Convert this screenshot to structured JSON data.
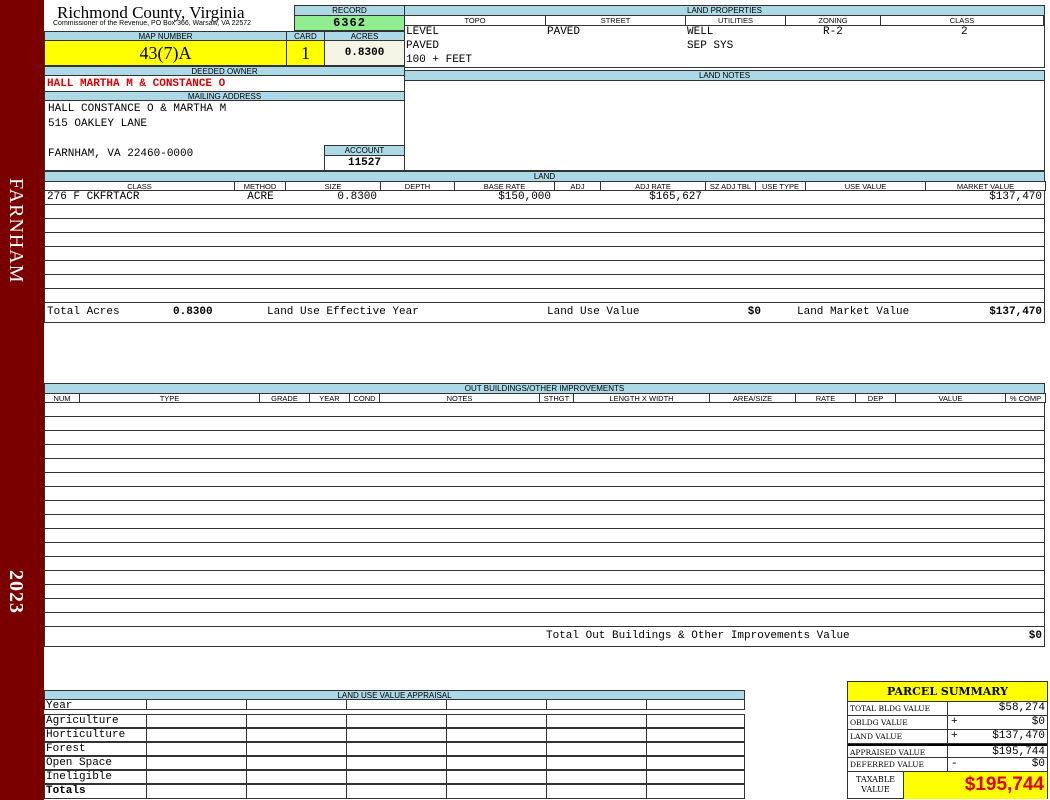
{
  "sidebar": {
    "town": "FARNHAM",
    "year": "2023"
  },
  "header": {
    "title": "Richmond County, Virginia",
    "subtitle": "Commissioner of the Revenue, PO Box 366, Warsaw, VA 22572"
  },
  "record": {
    "label": "RECORD",
    "value": "6362"
  },
  "map": {
    "label": "MAP NUMBER",
    "value": "43(7)A"
  },
  "card": {
    "label": "CARD",
    "value": "1"
  },
  "acres": {
    "label": "ACRES",
    "value": "0.8300"
  },
  "owner": {
    "label": "DEEDED OWNER",
    "value": "HALL MARTHA M & CONSTANCE O"
  },
  "mailing": {
    "label": "MAILING ADDRESS",
    "line1": "HALL CONSTANCE O & MARTHA M",
    "line2": "515 OAKLEY LANE",
    "line3": "FARNHAM, VA 22460-0000"
  },
  "account": {
    "label": "ACCOUNT",
    "value": "11527"
  },
  "land_properties": {
    "label": "LAND PROPERTIES",
    "headers": [
      "TOPO",
      "STREET",
      "UTILITIES",
      "ZONING",
      "CLASS"
    ],
    "topo": [
      "LEVEL",
      "PAVED",
      "100 + FEET"
    ],
    "street": [
      "PAVED"
    ],
    "utilities": [
      "WELL",
      "SEP SYS"
    ],
    "zoning": "R-2",
    "class": "2"
  },
  "land_notes": {
    "label": "LAND NOTES"
  },
  "land": {
    "label": "LAND",
    "headers": [
      "CLASS",
      "METHOD",
      "SIZE",
      "DEPTH",
      "BASE RATE",
      "ADJ",
      "ADJ RATE",
      "SZ ADJ TBL",
      "USE TYPE",
      "USE VALUE",
      "MARKET VALUE"
    ],
    "rows": [
      [
        "276 F CKFRTACR",
        "ACRE",
        "0.8300",
        "",
        "$150,000",
        "",
        "$165,627",
        "",
        "",
        "",
        "$137,470"
      ]
    ],
    "totals": {
      "acres_label": "Total Acres",
      "acres": "0.8300",
      "eff_year_label": "Land Use Effective Year",
      "use_value_label": "Land Use Value",
      "use_value": "$0",
      "market_label": "Land Market Value",
      "market": "$137,470"
    }
  },
  "outbuildings": {
    "label": "OUT BUILDINGS/OTHER IMPROVEMENTS",
    "headers": [
      "NUM",
      "TYPE",
      "GRADE",
      "YEAR",
      "COND",
      "NOTES",
      "STHGT",
      "LENGTH X WIDTH",
      "AREA/SIZE",
      "RATE",
      "DEP",
      "VALUE",
      "% COMP"
    ],
    "total_label": "Total Out Buildings & Other Improvements Value",
    "total": "$0"
  },
  "land_use": {
    "label": "LAND USE VALUE APPRAISAL",
    "year_label": "Year",
    "rows": [
      "Agriculture",
      "Horticulture",
      "Forest",
      "Open Space",
      "Ineligible"
    ],
    "totals_label": "Totals"
  },
  "summary": {
    "title": "PARCEL SUMMARY",
    "rows": [
      {
        "label": "TOTAL BLDG VALUE",
        "op": "",
        "value": "$58,274"
      },
      {
        "label": "OBLDG VALUE",
        "op": "+",
        "value": "$0"
      },
      {
        "label": "LAND VALUE",
        "op": "+",
        "value": "$137,470"
      },
      {
        "label": "APPRAISED VALUE",
        "op": "",
        "value": "$195,744"
      },
      {
        "label": "DEFERRED VALUE",
        "op": "-",
        "value": "$0"
      }
    ],
    "taxable_label": "TAXABLE VALUE",
    "taxable": "$195,744"
  },
  "colors": {
    "sidebar": "#7a0000",
    "header_blue": "#add8e6",
    "highlight_yellow": "#ffff00",
    "record_green": "#90ee90",
    "owner_red": "#e00000"
  }
}
